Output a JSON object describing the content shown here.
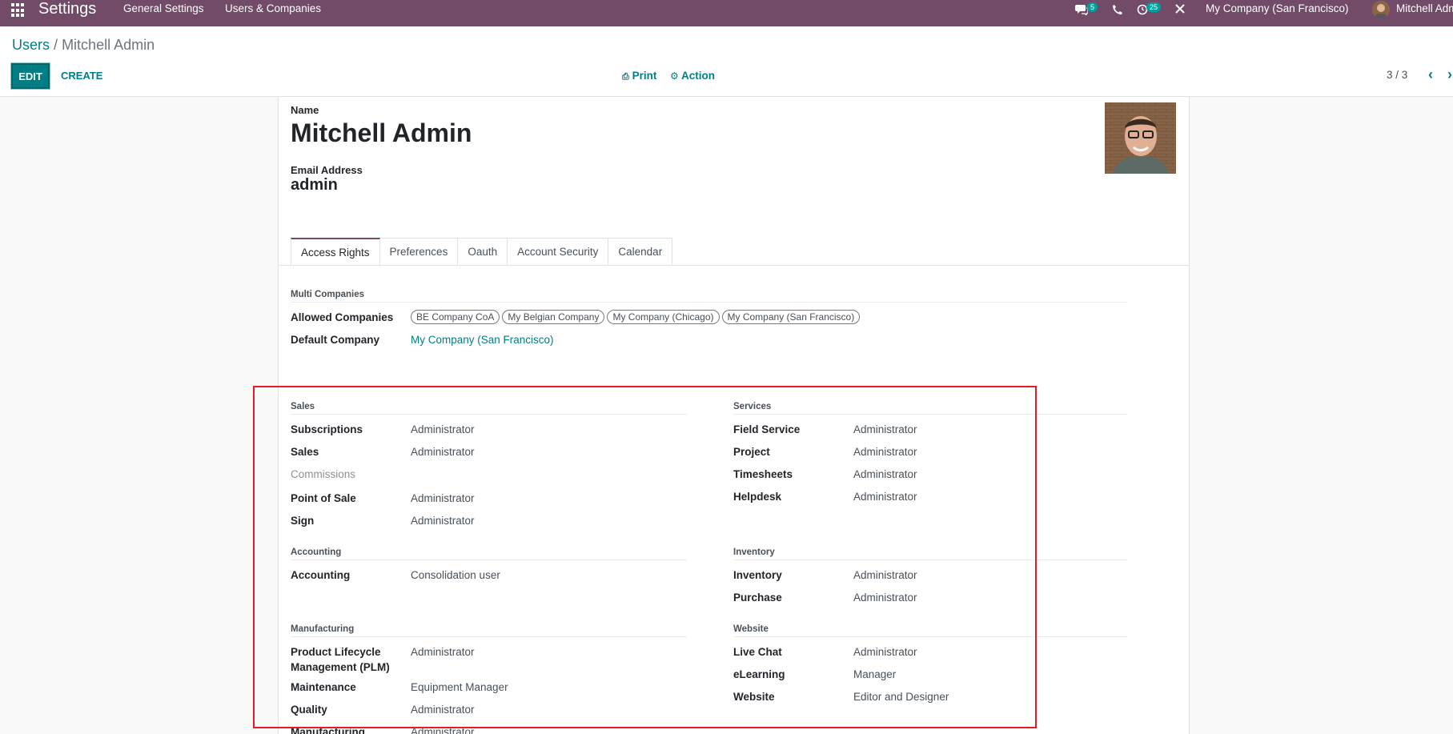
{
  "navbar": {
    "app_title": "Settings",
    "menu": [
      "General Settings",
      "Users & Companies"
    ],
    "messages_count": "5",
    "activities_count": "25",
    "company": "My Company (San Francisco)",
    "user": "Mitchell Admin"
  },
  "control_panel": {
    "breadcrumb_parent": "Users",
    "breadcrumb_sep": "/",
    "breadcrumb_current": "Mitchell Admin",
    "edit_label": "EDIT",
    "create_label": "CREATE",
    "print_label": "Print",
    "action_label": "Action",
    "pager": "3 / 3"
  },
  "form": {
    "name_label": "Name",
    "name_value": "Mitchell Admin",
    "email_label": "Email Address",
    "email_value": "admin",
    "tabs": [
      "Access Rights",
      "Preferences",
      "Oauth",
      "Account Security",
      "Calendar"
    ],
    "multi_companies": {
      "title": "Multi Companies",
      "allowed_label": "Allowed Companies",
      "allowed": [
        "BE Company CoA",
        "My Belgian Company",
        "My Company (Chicago)",
        "My Company (San Francisco)"
      ],
      "default_label": "Default Company",
      "default_value": "My Company (San Francisco)"
    },
    "groups": {
      "sales": {
        "title": "Sales",
        "rows": [
          {
            "label": "Subscriptions",
            "value": "Administrator"
          },
          {
            "label": "Sales",
            "value": "Administrator"
          },
          {
            "label": "Commissions",
            "value": ""
          },
          {
            "label": "Point of Sale",
            "value": "Administrator"
          },
          {
            "label": "Sign",
            "value": "Administrator"
          }
        ]
      },
      "services": {
        "title": "Services",
        "rows": [
          {
            "label": "Field Service",
            "value": "Administrator"
          },
          {
            "label": "Project",
            "value": "Administrator"
          },
          {
            "label": "Timesheets",
            "value": "Administrator"
          },
          {
            "label": "Helpdesk",
            "value": "Administrator"
          }
        ]
      },
      "accounting": {
        "title": "Accounting",
        "rows": [
          {
            "label": "Accounting",
            "value": "Consolidation user"
          }
        ]
      },
      "inventory": {
        "title": "Inventory",
        "rows": [
          {
            "label": "Inventory",
            "value": "Administrator"
          },
          {
            "label": "Purchase",
            "value": "Administrator"
          }
        ]
      },
      "manufacturing": {
        "title": "Manufacturing",
        "rows": [
          {
            "label": "Product Lifecycle",
            "label2": "Management (PLM)",
            "value": "Administrator"
          },
          {
            "label": "Maintenance",
            "value": "Equipment Manager"
          },
          {
            "label": "Quality",
            "value": "Administrator"
          },
          {
            "label": "Manufacturing",
            "value": "Administrator"
          }
        ]
      },
      "website": {
        "title": "Website",
        "rows": [
          {
            "label": "Live Chat",
            "value": "Administrator"
          },
          {
            "label": "eLearning",
            "value": "Manager"
          },
          {
            "label": "Website",
            "value": "Editor and Designer"
          }
        ]
      }
    }
  },
  "colors": {
    "navbar": "#714b67",
    "accent": "#017e84",
    "highlight": "#e51c23"
  }
}
